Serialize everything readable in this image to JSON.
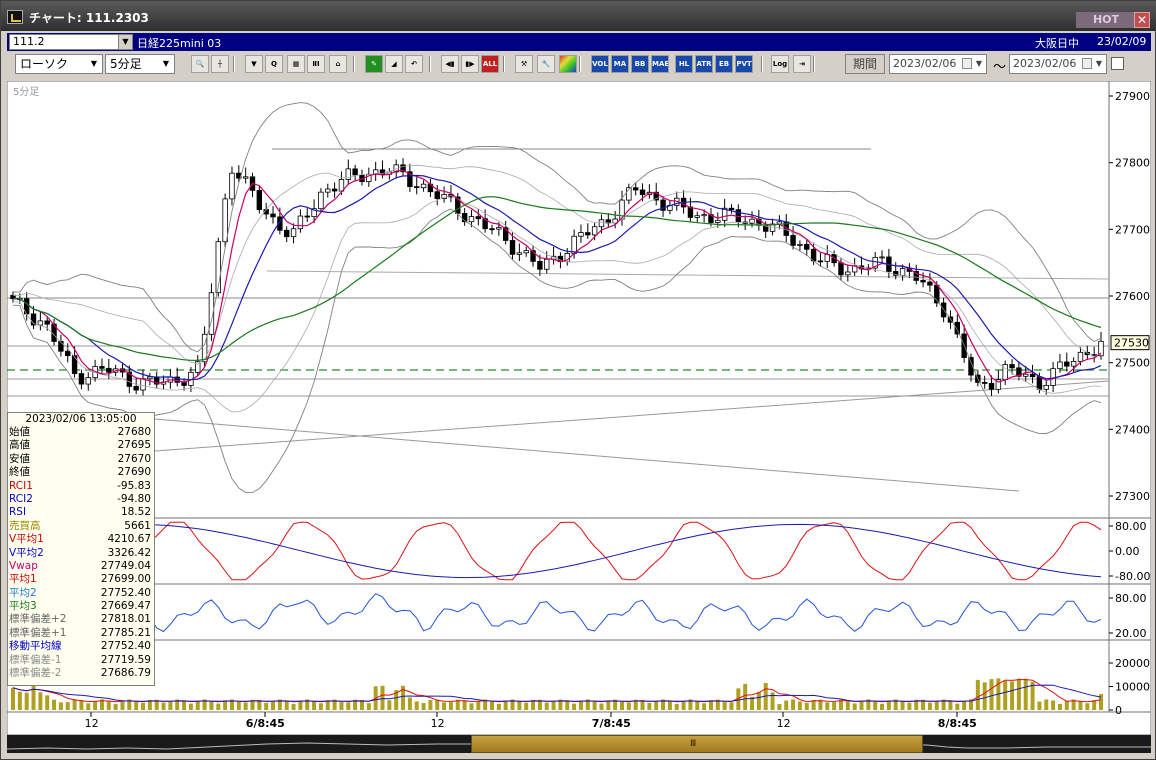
{
  "window": {
    "title": "チャート: 111.2303",
    "hot_label": "HOT",
    "close_glyph": "✕"
  },
  "symbol_bar": {
    "code": "111.2",
    "name": "日経225mini 03",
    "market": "大阪日中",
    "date": "23/02/09"
  },
  "toolbar": {
    "chart_type": "ローソク",
    "interval": "5分足",
    "period_label": "期間",
    "date_from": "2023/02/06",
    "date_to": "2023/02/06",
    "tilde": "～",
    "buttons": [
      {
        "name": "zoom-icon",
        "text": "🔍"
      },
      {
        "name": "crosshair-icon",
        "text": "┼"
      },
      {
        "name": "candle-down-icon",
        "text": "▼"
      },
      {
        "name": "candle-search-icon",
        "text": "Q"
      },
      {
        "name": "multi-chart-icon",
        "text": "▦"
      },
      {
        "name": "compare-icon",
        "text": "ⅡⅠ"
      },
      {
        "name": "lock-icon",
        "text": "⌂"
      },
      {
        "name": "pen-icon",
        "text": "✎"
      },
      {
        "name": "eraser-icon",
        "text": "◢"
      },
      {
        "name": "undo-icon",
        "text": "↶"
      },
      {
        "name": "candle-left-icon",
        "text": "◀▮"
      },
      {
        "name": "candle-right-icon",
        "text": "▮▶"
      },
      {
        "name": "all-button",
        "text": "ALL"
      },
      {
        "name": "tool-icon",
        "text": "⚒"
      },
      {
        "name": "wrench-icon",
        "text": "🔧"
      },
      {
        "name": "palette-icon",
        "text": ""
      },
      {
        "name": "vol-button",
        "text": "VOL"
      },
      {
        "name": "ma-button",
        "text": "MA"
      },
      {
        "name": "bb-button",
        "text": "BB"
      },
      {
        "name": "mae-button",
        "text": "MAE"
      },
      {
        "name": "hl-button",
        "text": "HL"
      },
      {
        "name": "atr-button",
        "text": "ATR"
      },
      {
        "name": "ebea-button",
        "text": "EB"
      },
      {
        "name": "pvt-button",
        "text": "PVT"
      },
      {
        "name": "log-button",
        "text": "Log"
      },
      {
        "name": "export-icon",
        "text": "⇥"
      }
    ]
  },
  "chart": {
    "interval_label": "5分足",
    "price_axis": [
      "27900",
      "27800",
      "27700",
      "27600",
      "27500",
      "27400",
      "27300"
    ],
    "current_price": "27530",
    "rci_axis": [
      "80.00",
      "0.00",
      "-80.00"
    ],
    "rsi_axis": [
      "80.00",
      "20.00"
    ],
    "volume_axis": [
      "20000",
      "10000",
      "0"
    ],
    "time_axis": [
      "12",
      "6/8:45",
      "12",
      "7/8:45",
      "12",
      "8/8:45"
    ],
    "colors": {
      "background": "#ffffff",
      "upper_candle": "#000000",
      "ma_short": "#cc0066",
      "ma_mid": "#1a1ab0",
      "ma_long": "#1a7a1a",
      "bollinger": "#808080",
      "dash_line": "#2a8a2a",
      "rci_red": "#dd1111",
      "rci_blue": "#1a1ab0",
      "rsi": "#2255dd",
      "volume": "#b0a020"
    }
  },
  "chart_data": {
    "type": "line",
    "series": [
      {
        "values": [
          27590,
          27560,
          27480,
          27490,
          27470,
          27470,
          27490,
          27800,
          27730,
          27690,
          27760,
          27780,
          27790,
          27770,
          27740,
          27710,
          27680,
          27640,
          27680,
          27710,
          27760,
          27740,
          27720,
          27720,
          27710,
          27690,
          27650,
          27640,
          27650,
          27630,
          27580,
          27460,
          27490,
          27470,
          27500,
          27530
        ]
      }
    ]
  },
  "info_panel": {
    "timestamp": "2023/02/06  13:05:00",
    "rows": [
      {
        "label": "始値",
        "value": "27680",
        "color": "#000000"
      },
      {
        "label": "高値",
        "value": "27695",
        "color": "#000000"
      },
      {
        "label": "安値",
        "value": "27670",
        "color": "#000000"
      },
      {
        "label": "終値",
        "value": "27690",
        "color": "#000000"
      },
      {
        "label": "RCI1",
        "value": "-95.83",
        "color": "#cc0000"
      },
      {
        "label": "RCI2",
        "value": "-94.80",
        "color": "#0000cc"
      },
      {
        "label": "RSI",
        "value": "18.52",
        "color": "#0000cc"
      },
      {
        "label": "売買高",
        "value": "5661",
        "color": "#9a8a00"
      },
      {
        "label": "V平均1",
        "value": "4210.67",
        "color": "#cc0000"
      },
      {
        "label": "V平均2",
        "value": "3326.42",
        "color": "#0000cc"
      },
      {
        "label": "Vwap",
        "value": "27749.04",
        "color": "#cc0066"
      },
      {
        "label": "平均1",
        "value": "27699.00",
        "color": "#cc0000"
      },
      {
        "label": "平均2",
        "value": "27752.40",
        "color": "#1a7acc"
      },
      {
        "label": "平均3",
        "value": "27669.47",
        "color": "#1a7a1a"
      },
      {
        "label": "標準偏差+2",
        "value": "27818.01",
        "color": "#666666"
      },
      {
        "label": "標準偏差+1",
        "value": "27785.21",
        "color": "#666666"
      },
      {
        "label": "移動平均線",
        "value": "27752.40",
        "color": "#0000cc"
      },
      {
        "label": "標準偏差-1",
        "value": "27719.59",
        "color": "#888888"
      },
      {
        "label": "標準偏差-2",
        "value": "27686.79",
        "color": "#888888"
      }
    ]
  }
}
